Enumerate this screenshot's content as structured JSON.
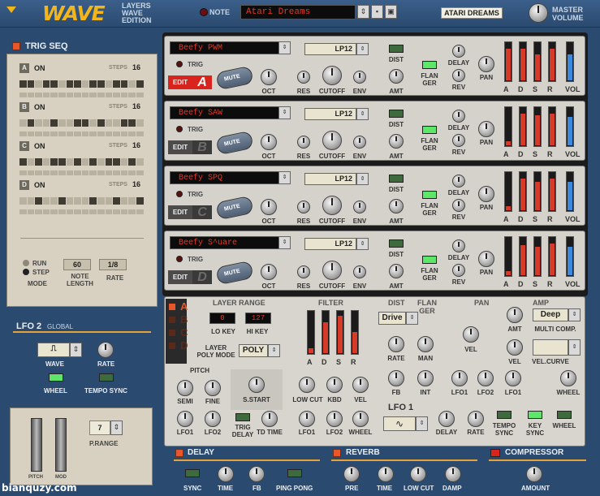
{
  "header": {
    "logo": "WAVE",
    "logo_sub": [
      "LAYERS",
      "WAVE",
      "EDITION"
    ],
    "note_label": "NOTE",
    "patch_name": "Atari Dreams",
    "patch_label": "ATARI DREAMS",
    "master_volume_label": [
      "MASTER",
      "VOLUME"
    ]
  },
  "trig_seq": {
    "title": "TRIG SEQ",
    "rows": [
      {
        "letter": "A",
        "state": "ON",
        "steps_label": "STEPS",
        "steps": "16",
        "pattern": [
          1,
          1,
          0,
          1,
          1,
          0,
          1,
          1,
          0,
          1,
          1,
          0,
          1,
          1,
          0,
          1
        ]
      },
      {
        "letter": "B",
        "state": "ON",
        "steps_label": "STEPS",
        "steps": "16",
        "pattern": [
          0,
          1,
          0,
          0,
          1,
          0,
          0,
          1,
          1,
          0,
          1,
          0,
          0,
          1,
          1,
          0
        ]
      },
      {
        "letter": "C",
        "state": "ON",
        "steps_label": "STEPS",
        "steps": "16",
        "pattern": [
          1,
          0,
          1,
          0,
          1,
          1,
          0,
          1,
          0,
          1,
          0,
          1,
          1,
          0,
          1,
          0
        ]
      },
      {
        "letter": "D",
        "state": "ON",
        "steps_label": "STEPS",
        "steps": "16",
        "pattern": [
          0,
          0,
          1,
          0,
          0,
          1,
          0,
          0,
          0,
          1,
          0,
          0,
          1,
          0,
          0,
          1
        ]
      }
    ],
    "mode_run": "RUN",
    "mode_step": "STEP",
    "mode_label": "MODE",
    "note_length_value": "60",
    "note_length_label": [
      "NOTE",
      "LENGTH"
    ],
    "rate_value": "1/8",
    "rate_label": "RATE"
  },
  "layers": [
    {
      "name": "Beefy PWM",
      "letter": "A",
      "edit": "EDIT",
      "trig": "TRIG",
      "mute": "MUTE",
      "filter": "LP12",
      "active": true,
      "flanger_on": true,
      "levels": {
        "a": 0.85,
        "d": 0.85,
        "s": 0.7,
        "r": 0.85,
        "vol": 0.7
      }
    },
    {
      "name": "Beefy SAW",
      "letter": "B",
      "edit": "EDIT",
      "trig": "TRIG",
      "mute": "MUTE",
      "filter": "LP12",
      "active": false,
      "flanger_on": true,
      "levels": {
        "a": 0.1,
        "d": 0.85,
        "s": 0.8,
        "r": 0.85,
        "vol": 0.75
      }
    },
    {
      "name": "Beefy SPQ",
      "letter": "C",
      "edit": "EDIT",
      "trig": "TRIG",
      "mute": "MUTE",
      "filter": "LP12",
      "active": false,
      "flanger_on": true,
      "levels": {
        "a": 0.1,
        "d": 0.85,
        "s": 0.75,
        "r": 0.85,
        "vol": 0.75
      }
    },
    {
      "name": "Beefy S^uare",
      "letter": "D",
      "edit": "EDIT",
      "trig": "TRIG",
      "mute": "MUTE",
      "filter": "LP12",
      "active": false,
      "flanger_on": true,
      "levels": {
        "a": 0.1,
        "d": 0.8,
        "s": 0.75,
        "r": 0.85,
        "vol": 0.75
      }
    }
  ],
  "layer_labels": {
    "oct": "OCT",
    "res": "RES",
    "cutoff": "CUTOFF",
    "env": "ENV",
    "dist": "DIST",
    "amt": "AMT",
    "flanger": [
      "FLAN",
      "GER"
    ],
    "delay": "DELAY",
    "rev": "REV",
    "pan": "PAN",
    "a": "A",
    "d": "D",
    "s": "S",
    "r": "R",
    "vol": "VOL"
  },
  "lower": {
    "layer_selectors": [
      "A",
      "B",
      "C",
      "D"
    ],
    "layer_range_title": "LAYER RANGE",
    "lo_key_value": "0",
    "hi_key_value": "127",
    "lo_key_label": "LO KEY",
    "hi_key_label": "HI KEY",
    "poly_mode_label": [
      "LAYER",
      "POLY MODE"
    ],
    "poly_mode_value": "POLY",
    "pitch_title": "PITCH",
    "semi": "SEMI",
    "fine": "FINE",
    "s_start": "S.START",
    "lfo1": "LFO1",
    "lfo2": "LFO2",
    "trig_delay": [
      "TRIG",
      "DELAY"
    ],
    "td_time": "TD TIME",
    "filter_title": "FILTER",
    "filter_env_labels": [
      "A",
      "D",
      "S",
      "R"
    ],
    "low_cut": "LOW CUT",
    "kbd": "KBD",
    "vel": "VEL",
    "wheel": "WHEEL",
    "dist_title": "DIST",
    "dist_value": "Drive",
    "rate": "RATE",
    "man": "MAN",
    "fb": "FB",
    "int": "INT",
    "flanger_title": [
      "FLAN",
      "GER"
    ],
    "pan_title": "PAN",
    "pan_vel": "VEL",
    "amp_title": "AMP",
    "amp_amt": "AMT",
    "amp_value": "Deep",
    "multi_comp": "MULTI COMP.",
    "amp_vel": "VEL",
    "vel_curve": "VEL.CURVE",
    "lfo1_title": "LFO 1",
    "lfo1_delay": "DELAY",
    "lfo1_rate": "RATE",
    "tempo_sync": [
      "TEMPO",
      "SYNC"
    ],
    "key_sync": [
      "KEY",
      "SYNC"
    ],
    "lfo1_wheel": "WHEEL",
    "bottom_lfo1a": "LFO1",
    "bottom_lfo2a": "LFO2",
    "bottom_lfo1b": "LFO1",
    "bottom_lfo2b": "LFO2",
    "bottom_lfo1c": "LFO1",
    "bottom_lfo2c": "LFO2",
    "bottom_lfo1d": "LFO1",
    "bottom_lfo2d": "LFO2",
    "amp_lfo1": "LFO1",
    "amp_wheel": "WHEEL"
  },
  "lfo2": {
    "title": "LFO 2",
    "sub": "GLOBAL",
    "wave": "WAVE",
    "rate": "RATE",
    "wheel": "WHEEL",
    "tempo_sync": "TEMPO SYNC",
    "pitch_wheel": "PITCH",
    "mod_wheel": "MOD",
    "prange_value": "7",
    "prange_label": "P.RANGE"
  },
  "fx": {
    "delay_title": "DELAY",
    "delay_sync": "SYNC",
    "delay_time": "TIME",
    "delay_fb": "FB",
    "delay_pingpong": "PING PONG",
    "reverb_title": "REVERB",
    "reverb_pre": "PRE",
    "reverb_time": "TIME",
    "reverb_lowcut": "LOW CUT",
    "reverb_damp": "DAMP",
    "comp_title": "COMPRESSOR",
    "comp_amount": "AMOUNT"
  },
  "watermark": "bianquzy.com",
  "colors": {
    "accent": "#f2b51c",
    "panel": "#2b4a6f",
    "display_text": "#e03a2a",
    "led_red": "#d8241c",
    "led_green": "#5ee66a"
  }
}
